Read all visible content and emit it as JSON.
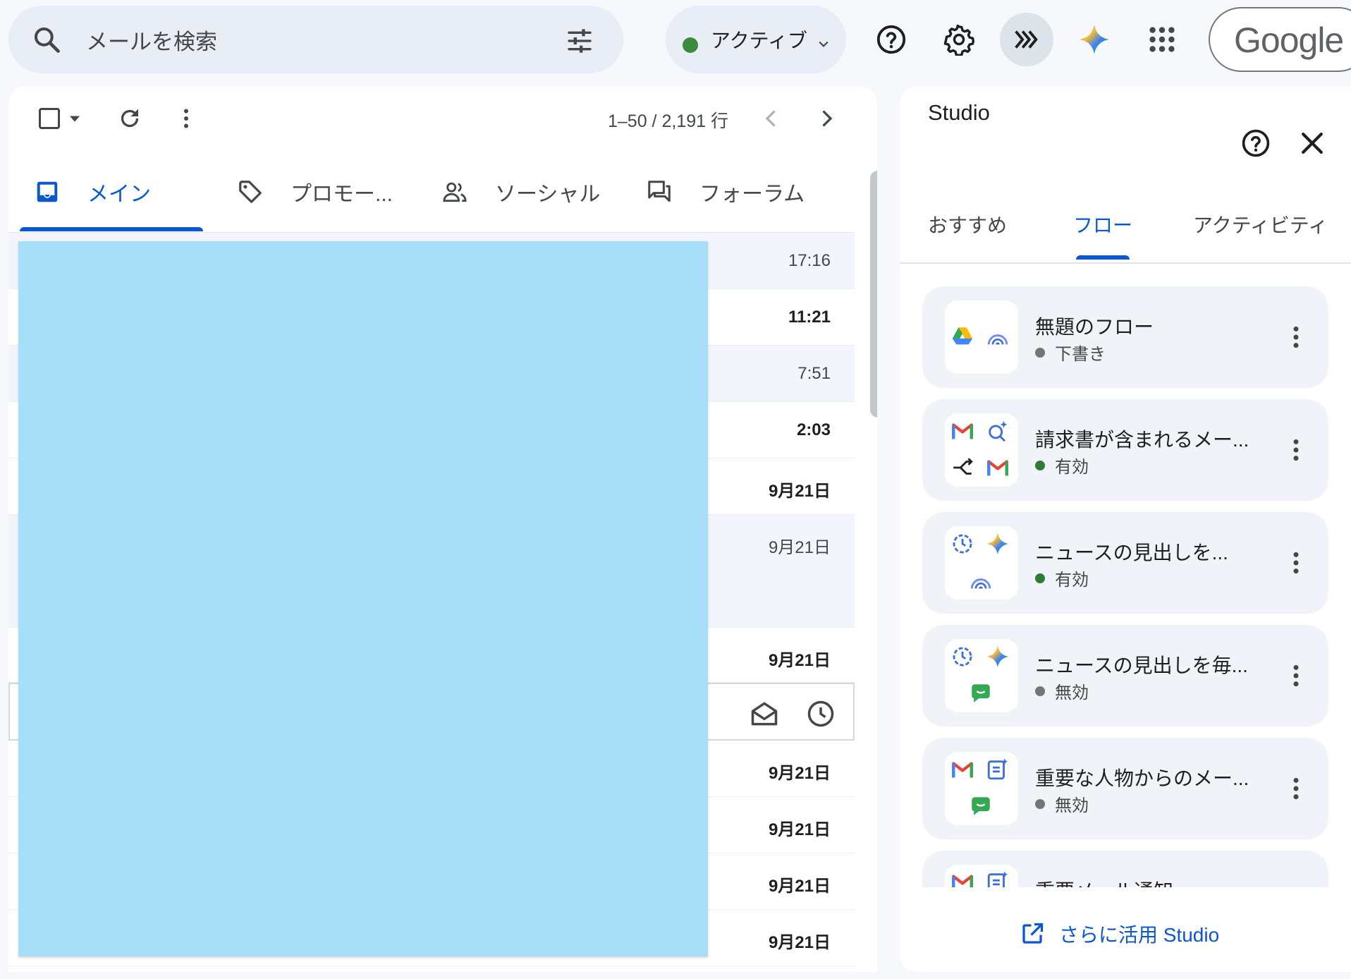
{
  "search": {
    "placeholder": "メールを検索"
  },
  "status": {
    "label": "アクティブ",
    "color": "#3a8a3f"
  },
  "account": {
    "label": "Google"
  },
  "icons": [
    "search-icon",
    "tune-icon",
    "help-icon",
    "gear-icon",
    "workflow-icon",
    "gemini-icon",
    "apps-grid-icon"
  ],
  "toolbar": {
    "pagination": "1–50 / 2,191 行"
  },
  "tabs": [
    {
      "label": "メイン",
      "icon": "inbox-icon"
    },
    {
      "label": "プロモー...",
      "icon": "tag-icon"
    },
    {
      "label": "ソーシャル",
      "icon": "people-icon"
    },
    {
      "label": "フォーラム",
      "icon": "forum-icon"
    }
  ],
  "mail": {
    "rows": [
      {
        "time": "17:16",
        "read": true
      },
      {
        "time": "11:21",
        "read": false
      },
      {
        "time": "7:51",
        "read": true
      },
      {
        "time": "2:03",
        "read": false
      },
      {
        "time": "9月21日",
        "read": false
      },
      {
        "time": "9月21日",
        "read": true
      },
      {
        "time": "9月21日",
        "read": false
      },
      {
        "time": "",
        "read": false
      },
      {
        "time": "9月21日",
        "read": false
      },
      {
        "time": "9月21日",
        "read": false
      },
      {
        "time": "9月21日",
        "read": false
      },
      {
        "time": "9月21日",
        "read": false
      }
    ]
  },
  "studio": {
    "title": "Studio",
    "tabs": [
      "おすすめ",
      "フロー",
      "アクティビティ"
    ],
    "flows": [
      {
        "name": "無題のフロー",
        "status": "下書き",
        "status_color": "#757575"
      },
      {
        "name": "請求書が含まれるメー...",
        "status": "有効",
        "status_color": "#2e7d32"
      },
      {
        "name": "ニュースの見出しを...",
        "status": "有効",
        "status_color": "#2e7d32"
      },
      {
        "name": "ニュースの見出しを毎...",
        "status": "無効",
        "status_color": "#757575"
      },
      {
        "name": "重要な人物からのメー...",
        "status": "無効",
        "status_color": "#757575"
      },
      {
        "name": "重要メール通知",
        "status": "",
        "status_color": "#757575"
      }
    ],
    "more_link": "さらに活用 Studio"
  },
  "colors": {
    "accent": "#0b57d0",
    "redaction": "#a7dff8",
    "card_bg": "#f0f4f9"
  }
}
